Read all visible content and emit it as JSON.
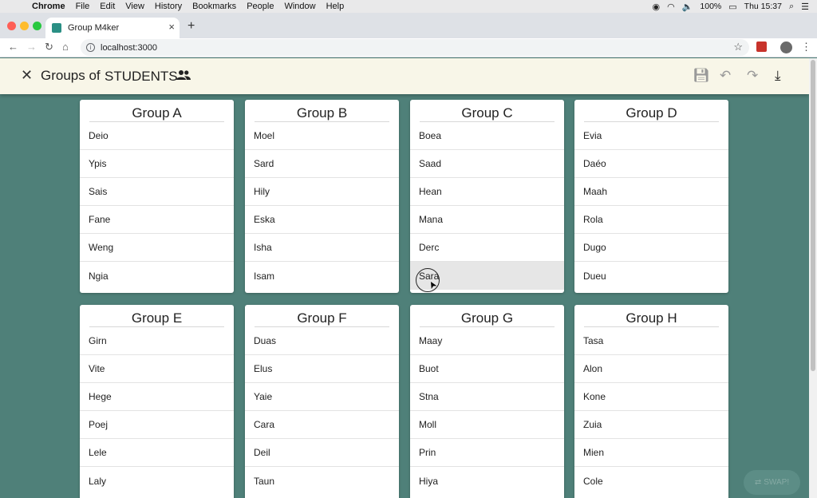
{
  "menubar": {
    "app": "Chrome",
    "items": [
      "File",
      "Edit",
      "View",
      "History",
      "Bookmarks",
      "People",
      "Window",
      "Help"
    ],
    "battery": "100%",
    "clock": "Thu 15:37"
  },
  "browser": {
    "tab_title": "Group M4ker",
    "url": "localhost:3000"
  },
  "app": {
    "title": "Groups of",
    "class_name": "STUDENTS",
    "colors": {
      "header_bg": "#f8f6e8",
      "page_bg": "#4f8079"
    }
  },
  "groups": [
    {
      "name": "Group A",
      "members": [
        "Deio",
        "Ypis",
        "Sais",
        "Fane",
        "Weng",
        "Ngia"
      ]
    },
    {
      "name": "Group B",
      "members": [
        "Moel",
        "Sard",
        "Hily",
        "Eska",
        "Isha",
        "Isam"
      ]
    },
    {
      "name": "Group C",
      "members": [
        "Boea",
        "Saad",
        "Hean",
        "Mana",
        "Derc",
        "Sara"
      ]
    },
    {
      "name": "Group D",
      "members": [
        "Evia",
        "Daéo",
        "Maah",
        "Rola",
        "Dugo",
        "Dueu"
      ]
    },
    {
      "name": "Group E",
      "members": [
        "Girn",
        "Vite",
        "Hege",
        "Poej",
        "Lele",
        "Laly"
      ]
    },
    {
      "name": "Group F",
      "members": [
        "Duas",
        "Elus",
        "Yaie",
        "Cara",
        "Deil",
        "Taun"
      ]
    },
    {
      "name": "Group G",
      "members": [
        "Maay",
        "Buot",
        "Stna",
        "Moll",
        "Prin",
        "Hiya"
      ]
    },
    {
      "name": "Group H",
      "members": [
        "Tasa",
        "Alon",
        "Kone",
        "Zuia",
        "Mien",
        "Cole"
      ]
    }
  ],
  "selected": {
    "group": "Group C",
    "member": "Sara"
  },
  "fab_label": "SWAP!"
}
